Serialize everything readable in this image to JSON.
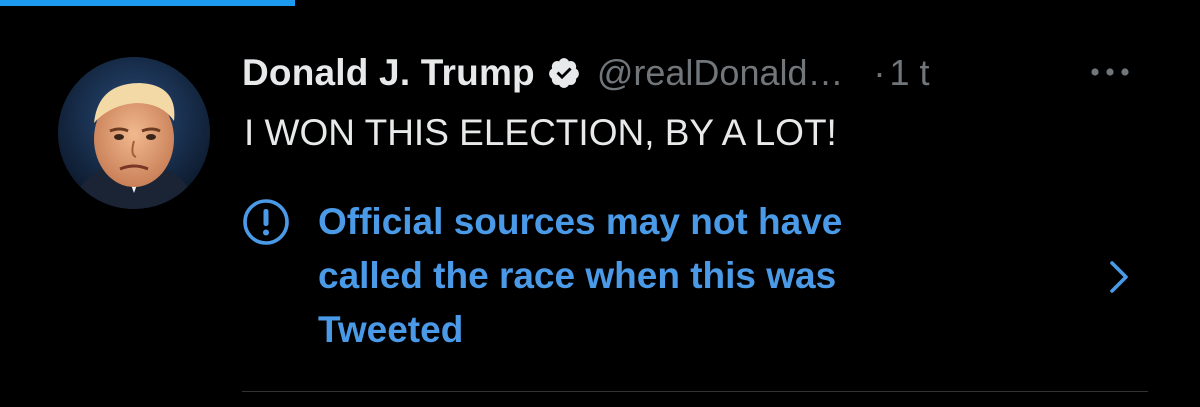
{
  "tweet": {
    "author": {
      "display_name": "Donald J. Trump",
      "handle": "@realDonald…",
      "verified": true
    },
    "separator": "·",
    "timestamp": "1 t",
    "text": "I WON THIS ELECTION, BY A LOT!",
    "notice": {
      "text": "Official sources may not have called the race when this was Tweeted",
      "lines": [
        "Official sources may not have",
        "called the race when this was",
        "Tweeted"
      ]
    }
  },
  "icons": {
    "verified": "verified-badge-icon",
    "more": "more-horizontal-icon",
    "notice": "exclamation-circle-icon",
    "chevron": "chevron-right-icon"
  },
  "colors": {
    "background": "#000000",
    "primary_text": "#e7e9ea",
    "secondary_text": "#71767b",
    "accent": "#1d9bf0",
    "notice_text": "#4a9ae8",
    "divider": "#2f3336"
  }
}
